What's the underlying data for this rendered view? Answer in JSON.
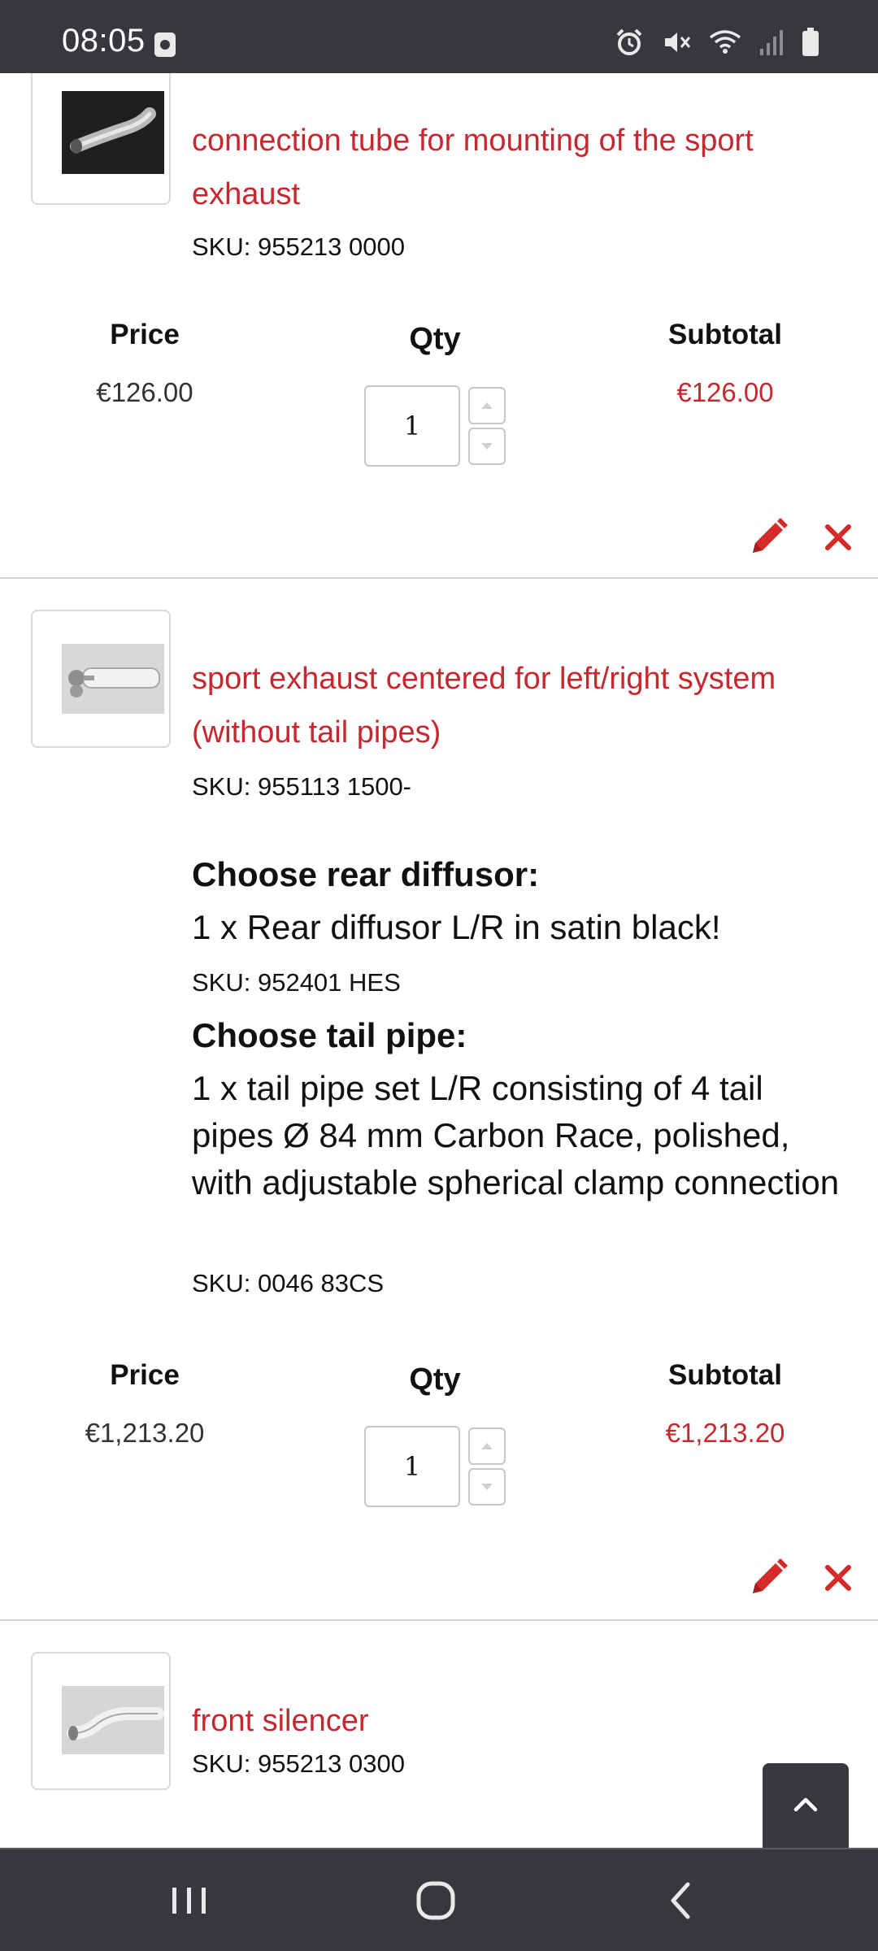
{
  "status_bar": {
    "time": "08:05"
  },
  "table_labels": {
    "price": "Price",
    "qty": "Qty",
    "subtotal": "Subtotal"
  },
  "items": [
    {
      "name": "connection tube for mounting of the sport exhaust",
      "sku": "SKU: 955213 0000",
      "price": "€126.00",
      "qty": "1",
      "subtotal": "€126.00"
    },
    {
      "name": "sport exhaust centered for left/right system (without tail pipes)",
      "sku": "SKU: 955113 1500-",
      "options": [
        {
          "heading": "Choose rear diffusor:",
          "value": "1 x Rear diffusor L/R in satin black!",
          "sku": "SKU: 952401 HES"
        },
        {
          "heading": "Choose tail pipe:",
          "value": "1 x tail pipe set L/R consisting of 4 tail pipes Ø 84 mm Carbon Race, polished, with adjustable spherical clamp connection",
          "sku": "SKU: 0046 83CS"
        }
      ],
      "price": "€1,213.20",
      "qty": "1",
      "subtotal": "€1,213.20"
    },
    {
      "name": "front silencer",
      "sku": "SKU: 955213 0300"
    }
  ],
  "colors": {
    "accent": "#c9272e",
    "system_bar": "#36383d"
  },
  "icons": {
    "edit": "pencil-icon",
    "remove": "close-icon",
    "scroll_top": "chevron-up-icon",
    "nav_recent": "recent-apps-icon",
    "nav_home": "home-icon",
    "nav_back": "back-icon"
  }
}
